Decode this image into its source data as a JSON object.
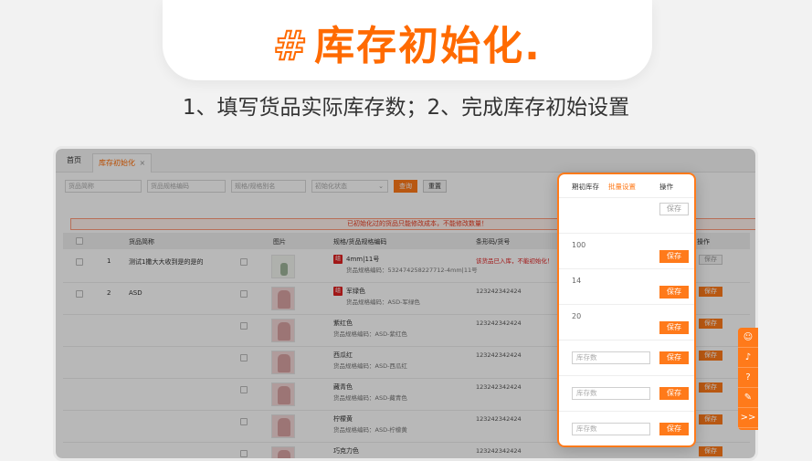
{
  "hero": {
    "hash": "#",
    "title": "库存初始化."
  },
  "subtitle": "1、填写货品实际库存数；2、完成库存初始设置",
  "tabs": [
    {
      "label": "首页"
    },
    {
      "label": "库存初始化",
      "close": "×"
    }
  ],
  "filters": {
    "goods_name_placeholder": "货品简称",
    "goods_code_placeholder": "货品规格编码",
    "spec_placeholder": "规格/规格别名",
    "status_placeholder": "初始化状态",
    "query_label": "查询",
    "reset_label": "重置"
  },
  "warning": "已初始化过的货品只能修改成本，不能修改数量！",
  "columns": {
    "checkbox": "",
    "name": "货品简称",
    "image": "图片",
    "spec": "规格/货品规格编码",
    "barcode": "条形码/货号",
    "op": "操作"
  },
  "rows": [
    {
      "index": "1",
      "name": "测试1撒大大收到是的是的",
      "spec": "4mm|11号",
      "spec_code": "货品规格编码：532474258227712-4mm|11号",
      "tag": "组",
      "barcode": "该货品已入库，不能初始化！",
      "save": "保存"
    },
    {
      "index": "2",
      "name": "ASD",
      "spec": "军绿色",
      "spec_code": "货品规格编码：ASD-军绿色",
      "tag": "组",
      "barcode": "123242342424",
      "save": "保存"
    },
    {
      "index": "",
      "name": "",
      "spec": "紫红色",
      "spec_code": "货品规格编码：ASD-紫红色",
      "tag": "",
      "barcode": "123242342424",
      "save": "保存"
    },
    {
      "index": "",
      "name": "",
      "spec": "西瓜红",
      "spec_code": "货品规格编码：ASD-西瓜红",
      "tag": "",
      "barcode": "123242342424",
      "save": "保存"
    },
    {
      "index": "",
      "name": "",
      "spec": "藏青色",
      "spec_code": "货品规格编码：ASD-藏青色",
      "tag": "",
      "barcode": "123242342424",
      "save": "保存"
    },
    {
      "index": "",
      "name": "",
      "spec": "柠檬黄",
      "spec_code": "货品规格编码：ASD-柠檬黄",
      "tag": "",
      "barcode": "123242342424",
      "save": "保存"
    },
    {
      "index": "",
      "name": "",
      "spec": "巧克力色",
      "spec_code": "货品规格编码：ASD-巧克力色",
      "tag": "",
      "barcode": "123242342424",
      "save": "保存"
    }
  ],
  "popup": {
    "col_stock": "期初库存",
    "batch_link": "批量设置",
    "col_op": "操作",
    "rows": [
      {
        "value": "",
        "input_placeholder": "",
        "save": "保存",
        "disabled": true
      },
      {
        "value": "100",
        "input_placeholder": "",
        "save": "保存"
      },
      {
        "value": "14",
        "input_placeholder": "",
        "save": "保存"
      },
      {
        "value": "20",
        "input_placeholder": "",
        "save": "保存"
      },
      {
        "value": "",
        "input_placeholder": "库存数",
        "save": "保存"
      },
      {
        "value": "",
        "input_placeholder": "库存数",
        "save": "保存"
      },
      {
        "value": "",
        "input_placeholder": "库存数",
        "save": "保存"
      }
    ]
  },
  "sidebar": [
    {
      "icon": "chat-icon",
      "glyph": "☺"
    },
    {
      "icon": "bell-icon",
      "glyph": "♪"
    },
    {
      "icon": "help-icon",
      "glyph": "?"
    },
    {
      "icon": "edit-icon",
      "glyph": "✎"
    },
    {
      "icon": "expand-icon",
      "glyph": ">>"
    }
  ],
  "colors": {
    "accent": "#ff7a1a",
    "title": "#ff6a00",
    "warn": "#e8381d"
  }
}
